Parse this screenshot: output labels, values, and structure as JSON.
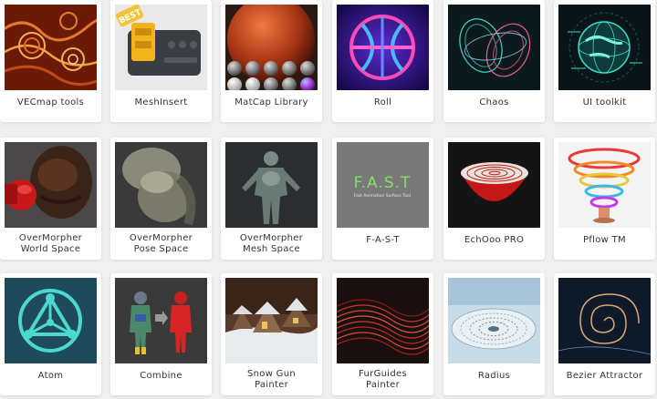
{
  "products": [
    {
      "id": "vecmap",
      "label": [
        "VECmap tools"
      ]
    },
    {
      "id": "meshinsert",
      "label": [
        "MeshInsert"
      ],
      "badge": "BEST"
    },
    {
      "id": "matcap",
      "label": [
        "MatCap Library"
      ]
    },
    {
      "id": "roll",
      "label": [
        "Roll"
      ]
    },
    {
      "id": "chaos",
      "label": [
        "Chaos"
      ]
    },
    {
      "id": "uitoolkit",
      "label": [
        "UI toolkit"
      ]
    },
    {
      "id": "om-world",
      "label": [
        "OverMorpher",
        "World Space"
      ]
    },
    {
      "id": "om-pose",
      "label": [
        "OverMorpher",
        "Pose Space"
      ]
    },
    {
      "id": "om-mesh",
      "label": [
        "OverMorpher",
        "Mesh Space"
      ]
    },
    {
      "id": "fast",
      "label": [
        "F-A-S-T"
      ],
      "thumb_title": "F.A.S.T",
      "thumb_subtitle": "Fast Animation Surface Tool"
    },
    {
      "id": "echooo",
      "label": [
        "EchOoo PRO"
      ]
    },
    {
      "id": "pflow",
      "label": [
        "Pflow TM"
      ]
    },
    {
      "id": "atom",
      "label": [
        "Atom"
      ]
    },
    {
      "id": "combine",
      "label": [
        "Combine"
      ]
    },
    {
      "id": "snowgun",
      "label": [
        "Snow Gun",
        "Painter"
      ]
    },
    {
      "id": "furguides",
      "label": [
        "FurGuides",
        "Painter"
      ]
    },
    {
      "id": "radius",
      "label": [
        "Radius"
      ]
    },
    {
      "id": "bezier",
      "label": [
        "Bezier Attractor"
      ]
    }
  ],
  "colors": {
    "page_bg": "#f0f0f1",
    "card_bg": "#ffffff",
    "label_text": "#333333",
    "fast_green": "#7ee06a"
  }
}
